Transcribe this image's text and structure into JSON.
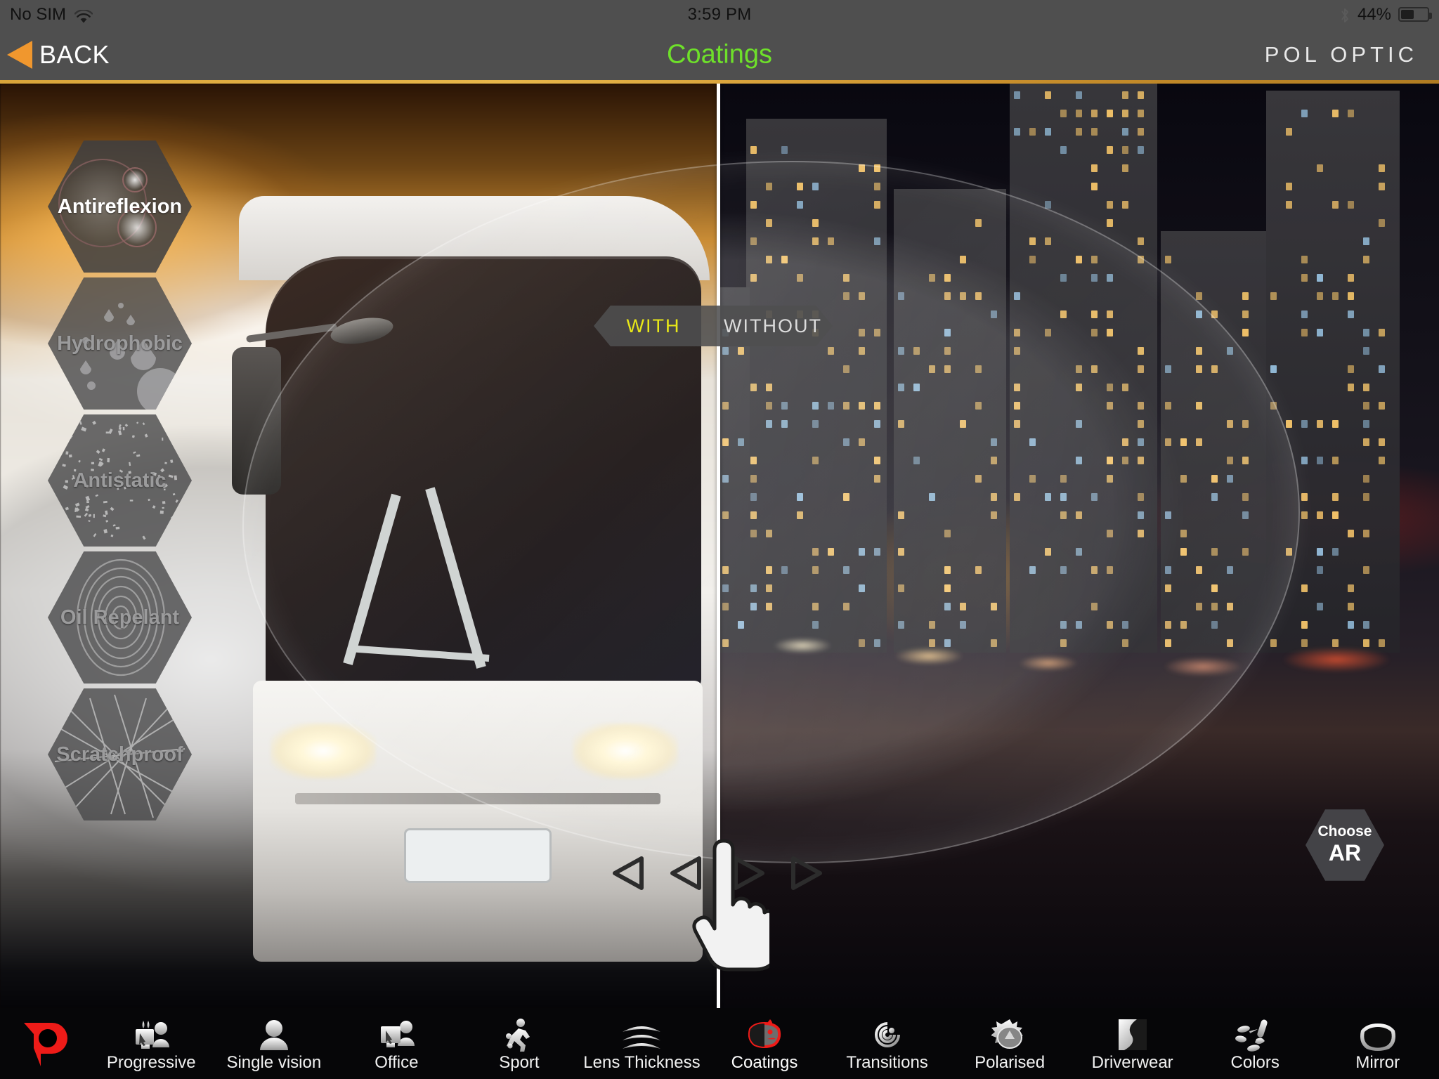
{
  "status_bar": {
    "carrier": "No SIM",
    "wifi_icon": "wifi-icon",
    "time": "3:59 PM",
    "bluetooth_icon": "bluetooth-icon",
    "battery_percent": "44%",
    "battery_level": 44
  },
  "header": {
    "back_label": "BACK",
    "back_icon": "back-triangle-icon",
    "title": "Coatings",
    "brand": "POL OPTIC",
    "title_color": "#6ee02a",
    "accent_color": "#f0972e",
    "rule_color": "#d9a43a"
  },
  "sidebar": {
    "items": [
      {
        "label": "Antireflexion",
        "icon": "lens-flare-icon",
        "active": true
      },
      {
        "label": "Hydrophobic",
        "icon": "water-droplets-icon",
        "active": false
      },
      {
        "label": "Antistatic",
        "icon": "dust-particles-icon",
        "active": false
      },
      {
        "label": "Oil Repelant",
        "icon": "fingerprint-icon",
        "active": false
      },
      {
        "label": "Scratchproof",
        "icon": "scratches-icon",
        "active": false
      }
    ]
  },
  "comparison": {
    "with_label": "WITH",
    "without_label": "WITHOUT",
    "with_color": "#e8e818",
    "without_color": "#dcdcdc",
    "split_position_percent": 50,
    "drag_hint_icon": "pointing-hand-icon",
    "arrow_left_icon": "triangle-left-icon",
    "arrow_right_icon": "triangle-right-icon"
  },
  "choose_ar": {
    "line1": "Choose",
    "line2": "AR"
  },
  "bottom_nav": {
    "logo_icon": "pol-optic-p-logo",
    "logo_color": "#ee1b18",
    "items": [
      {
        "label": "Progressive",
        "icon": "progressive-lens-icon",
        "active": false
      },
      {
        "label": "Single vision",
        "icon": "single-person-icon",
        "active": false
      },
      {
        "label": "Office",
        "icon": "office-screen-icon",
        "active": false
      },
      {
        "label": "Sport",
        "icon": "running-person-icon",
        "active": false
      },
      {
        "label": "Lens Thickness",
        "icon": "lens-layers-icon",
        "active": false
      },
      {
        "label": "Coatings",
        "icon": "coated-lens-icon",
        "active": true
      },
      {
        "label": "Transitions",
        "icon": "spiral-icon",
        "active": false
      },
      {
        "label": "Polarised",
        "icon": "sun-lens-icon",
        "active": false
      },
      {
        "label": "Driverwear",
        "icon": "road-curve-icon",
        "active": false
      },
      {
        "label": "Colors",
        "icon": "paintbrush-icon",
        "active": false
      },
      {
        "label": "Mirror",
        "icon": "mirror-lens-icon",
        "active": false
      }
    ]
  }
}
